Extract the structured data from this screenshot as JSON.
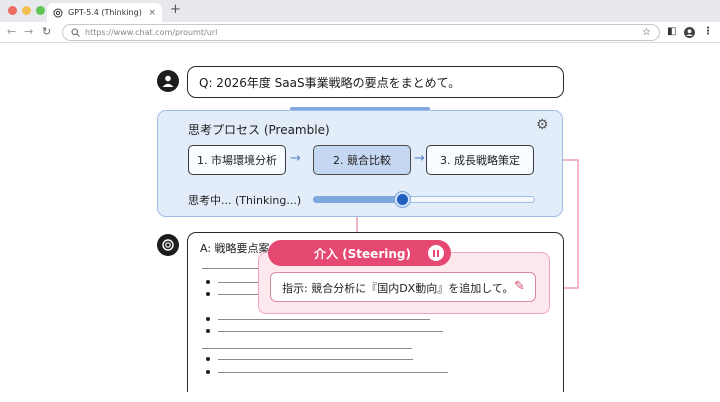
{
  "browser": {
    "tab_title": "GPT-5.4 (Thinking)",
    "tab_close": "×",
    "new_tab": "+",
    "url": "https://www.chat.com/proumt/url",
    "traffic_light_colors": [
      "#ec6a5e",
      "#f4bf4f",
      "#61c554"
    ]
  },
  "question": {
    "text": "Q: 2026年度 SaaS事業戦略の要点をまとめて。"
  },
  "preamble": {
    "title": "思考プロセス (Preamble)",
    "steps": [
      "1. 市場環境分析",
      "2. 競合比較",
      "3. 成長戦略策定"
    ],
    "active_step": 2,
    "thinking_label": "思考中... (Thinking...)",
    "progress": 0.4
  },
  "answer": {
    "prefix": "A: 戦略要点案"
  },
  "steering": {
    "label": "介入 (Steering)",
    "instruction": "指示: 競合分析に『国内DX動向』を追加して。"
  },
  "colors": {
    "preamble_bg": "#e3edf9",
    "accent_blue": "#1f5fbf",
    "steering_accent": "#e54870"
  }
}
